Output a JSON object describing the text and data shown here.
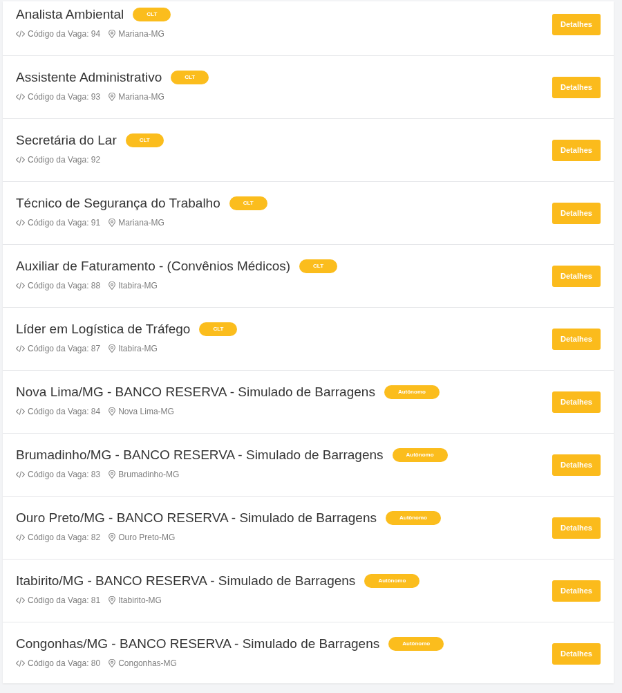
{
  "job_list": [
    {
      "title": "Analista Ambiental",
      "badge": "CLT",
      "code": "Código da Vaga: 94",
      "location": "Mariana-MG",
      "button": "Detalhes"
    },
    {
      "title": "Assistente Administrativo",
      "badge": "CLT",
      "code": "Código da Vaga: 93",
      "location": "Mariana-MG",
      "button": "Detalhes"
    },
    {
      "title": "Secretária do Lar",
      "badge": "CLT",
      "code": "Código da Vaga: 92",
      "button": "Detalhes"
    },
    {
      "title": "Técnico de Segurança do Trabalho",
      "badge": "CLT",
      "code": "Código da Vaga: 91",
      "location": "Mariana-MG",
      "button": "Detalhes"
    },
    {
      "title": "Auxiliar de Faturamento - (Convênios Médicos)",
      "badge": "CLT",
      "code": "Código da Vaga: 88",
      "location": "Itabira-MG",
      "button": "Detalhes"
    },
    {
      "title": "Líder em Logística de Tráfego",
      "badge": "CLT",
      "code": "Código da Vaga: 87",
      "location": "Itabira-MG",
      "button": "Detalhes"
    },
    {
      "title": "Nova Lima/MG - BANCO RESERVA - Simulado de Barragens",
      "badge": "Autônomo",
      "code": "Código da Vaga: 84",
      "location": "Nova Lima-MG",
      "button": "Detalhes"
    },
    {
      "title": "Brumadinho/MG - BANCO RESERVA - Simulado de Barragens",
      "badge": "Autônomo",
      "code": "Código da Vaga: 83",
      "location": "Brumadinho-MG",
      "button": "Detalhes"
    },
    {
      "title": "Ouro Preto/MG - BANCO RESERVA - Simulado de Barragens",
      "badge": "Autônomo",
      "code": "Código da Vaga: 82",
      "location": "Ouro Preto-MG",
      "button": "Detalhes"
    },
    {
      "title": "Itabirito/MG - BANCO RESERVA - Simulado de Barragens",
      "badge": "Autônomo",
      "code": "Código da Vaga: 81",
      "location": "Itabirito-MG",
      "button": "Detalhes"
    },
    {
      "title": "Congonhas/MG - BANCO RESERVA - Simulado de Barragens",
      "badge": "Autônomo",
      "code": "Código da Vaga: 80",
      "location": "Congonhas-MG",
      "button": "Detalhes"
    }
  ]
}
